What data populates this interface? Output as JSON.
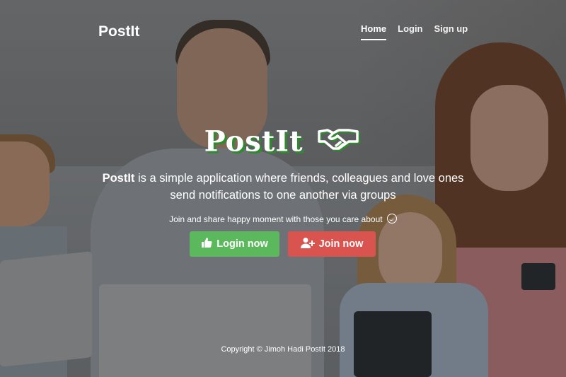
{
  "header": {
    "brand": "PostIt",
    "nav": [
      {
        "label": "Home",
        "active": true
      },
      {
        "label": "Login",
        "active": false
      },
      {
        "label": "Sign up",
        "active": false
      }
    ]
  },
  "hero": {
    "title": "PostIt",
    "title_icon": "handshake-icon",
    "tagline_brand": "PostIt",
    "tagline_line1_rest": " is a simple application where friends, colleagues and love ones",
    "tagline_line2": "send notifications to one another via groups",
    "subtext": "Join and share happy moment with those you care about",
    "subtext_icon": "smiley-icon",
    "buttons": {
      "login": {
        "label": "Login now",
        "icon": "thumbs-up-icon",
        "color": "#5cb85c"
      },
      "join": {
        "label": "Join now",
        "icon": "user-plus-icon",
        "color": "#d9534f"
      }
    }
  },
  "footer": {
    "copyright": "Copyright © Jimoh Hadi PostIt 2018"
  },
  "colors": {
    "title_shadow": "#2e8b2e",
    "text": "#ffffff"
  }
}
